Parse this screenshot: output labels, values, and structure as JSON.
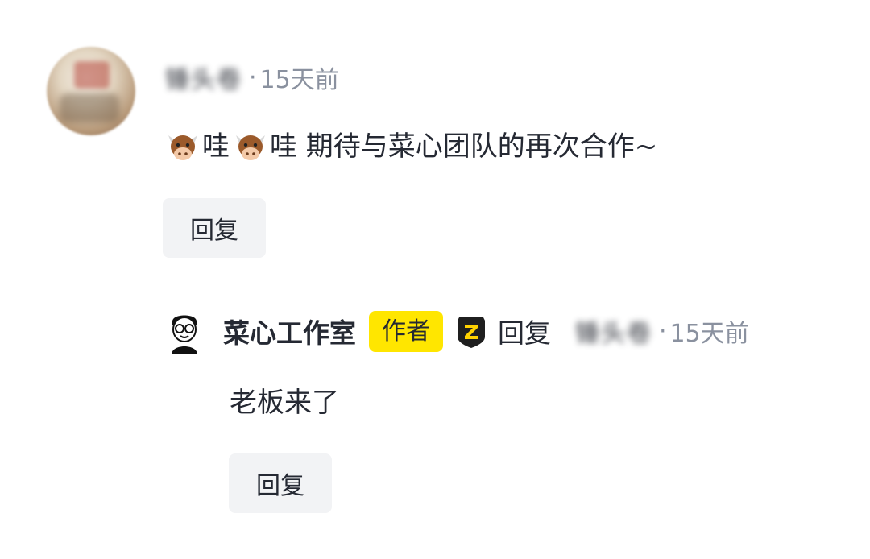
{
  "comment": {
    "user_name": "锤头卷",
    "separator": "·",
    "time": "15天前",
    "emoji_icon": "cow-face-icon",
    "text_part1": "哇",
    "text_part2": "哇 期待与菜心团队的再次合作~",
    "reply_label": "回复"
  },
  "reply": {
    "author_name": "菜心工作室",
    "author_badge": "作者",
    "level_icon": "z-shield-icon",
    "reply_word": "回复",
    "target_user": "锤头卷",
    "separator": "·",
    "time": "15天前",
    "text": "老板来了",
    "reply_label": "回复"
  },
  "colors": {
    "badge_yellow": "#ffe600",
    "reply_button_bg": "#f2f3f5",
    "meta_gray": "#8a919f"
  }
}
